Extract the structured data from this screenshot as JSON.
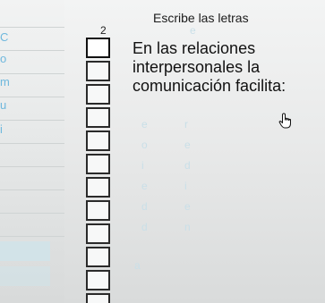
{
  "header": {
    "title": "Escribe las letras",
    "column_number": "2"
  },
  "question": {
    "line1": "En las relaciones",
    "line2": "interpersonales la",
    "line3": "comunicación facilita:"
  },
  "left_letters": [
    "C",
    "o",
    "m",
    "u",
    "i"
  ],
  "faint_letters": [
    "e",
    "e",
    "r",
    "o",
    "e",
    "i",
    "d",
    "e",
    "i",
    "d",
    "e",
    "d",
    "n",
    "a"
  ],
  "answer_boxes_count": 12,
  "icons": {
    "cursor": "hand-pointer-icon"
  }
}
